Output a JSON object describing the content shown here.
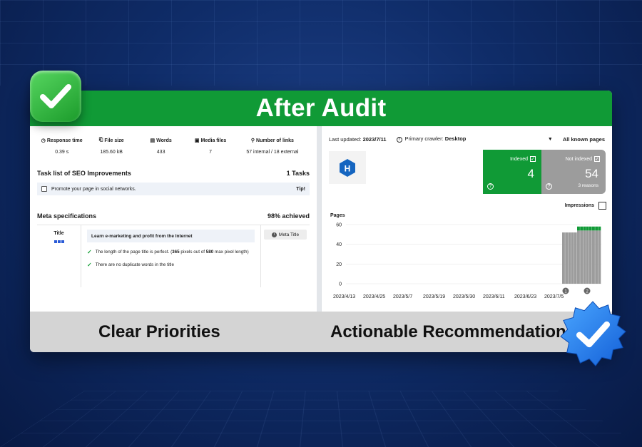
{
  "banner": {
    "title": "After Audit"
  },
  "left_panel": {
    "stats": [
      {
        "label": "Response time",
        "icon": "clock-icon",
        "value": "0.39 s"
      },
      {
        "label": "File size",
        "icon": "file-icon",
        "value": "185.60 kB"
      },
      {
        "label": "Words",
        "icon": "document-icon",
        "value": "433"
      },
      {
        "label": "Media files",
        "icon": "image-icon",
        "value": "7"
      },
      {
        "label": "Number of links",
        "icon": "link-icon",
        "value": "57 internal / 18 external"
      }
    ],
    "tasks": {
      "title": "Task list of SEO Improvements",
      "count": "1 Tasks",
      "items": [
        {
          "text": "Promote your page in social networks.",
          "tag": "Tip!"
        }
      ]
    },
    "meta": {
      "title": "Meta specifications",
      "achieved": "98% achieved",
      "row_label": "Title",
      "meta_title": "Learn e-marketing and profit from the Internet",
      "check_1_pre": "The length of the page title is perfect. (",
      "check_1_px": "365",
      "check_1_mid": " pixels out of ",
      "check_1_max": "580",
      "check_1_post": " max pixel length)",
      "check_2": "There are no duplicate words in the title",
      "button": "Meta Title"
    }
  },
  "right_panel": {
    "last_updated_label": "Last updated:",
    "last_updated": "2023/7/11",
    "crawler_label": "Primary crawler:",
    "crawler": "Desktop",
    "filter": "All known pages",
    "logo_letter": "H",
    "indexed": {
      "label": "Indexed",
      "value": "4"
    },
    "not_indexed": {
      "label": "Not indexed",
      "value": "54",
      "sub": "3 reasons"
    },
    "impressions_label": "Impressions",
    "pages_label": "Pages"
  },
  "chart_data": {
    "type": "bar",
    "ylim": [
      0,
      60
    ],
    "yticks": [
      "60",
      "40",
      "20",
      "0"
    ],
    "x_tick_labels": [
      "2023/4/13",
      "2023/4/25",
      "2023/5/7",
      "2023/5/19",
      "2023/5/30",
      "2023/6/11",
      "2023/6/23",
      "2023/7/5"
    ],
    "series": [
      {
        "name": "Not indexed",
        "color": "#9c9c9c",
        "values": [
          52,
          52,
          52,
          52,
          52,
          54,
          54,
          54,
          54,
          54,
          54,
          54,
          54
        ]
      },
      {
        "name": "Indexed",
        "color": "#109a36",
        "values": [
          0,
          0,
          0,
          0,
          0,
          4,
          4,
          4,
          4,
          4,
          4,
          4,
          4
        ]
      }
    ],
    "markers": [
      "1",
      "2"
    ]
  },
  "footer": {
    "left": "Clear Priorities",
    "right": "Actionable Recommendations"
  },
  "colors": {
    "green": "#109a36",
    "navy": "#0a2154",
    "grey": "#9c9c9c"
  }
}
